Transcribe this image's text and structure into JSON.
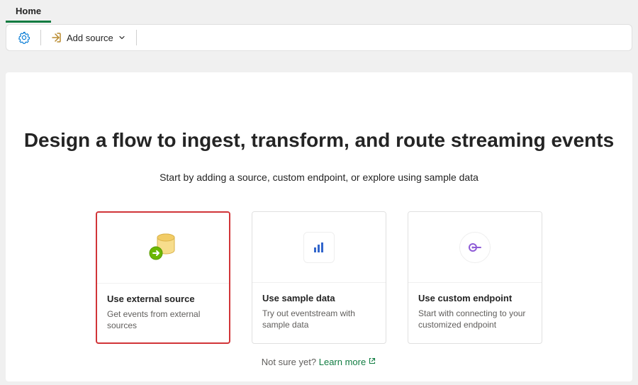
{
  "tabs": {
    "home": "Home"
  },
  "toolbar": {
    "add_source_label": "Add source"
  },
  "main": {
    "headline": "Design a flow to ingest, transform, and route streaming events",
    "subhead": "Start by adding a source, custom endpoint, or explore using sample data"
  },
  "cards": [
    {
      "title": "Use external source",
      "desc": "Get events from external sources",
      "highlight": true
    },
    {
      "title": "Use sample data",
      "desc": "Try out eventstream with sample data",
      "highlight": false
    },
    {
      "title": "Use custom endpoint",
      "desc": "Start with connecting to your customized endpoint",
      "highlight": false
    }
  ],
  "footer": {
    "prompt": "Not sure yet?",
    "link": "Learn more"
  }
}
